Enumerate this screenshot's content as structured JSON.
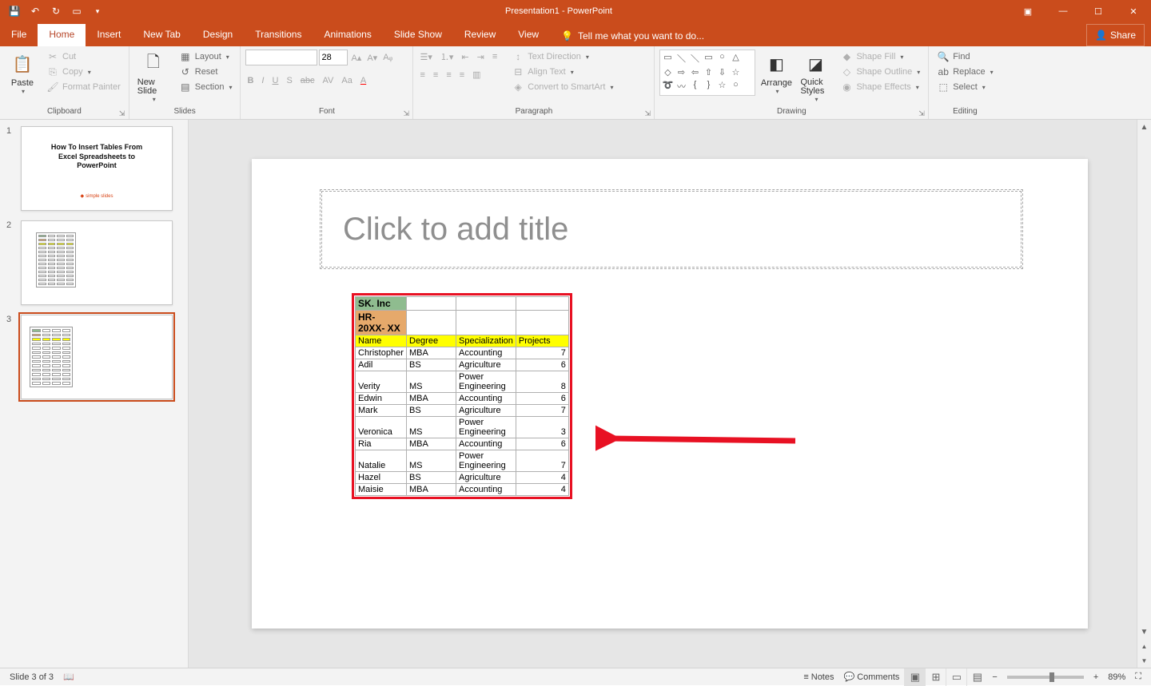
{
  "titlebar": {
    "title": "Presentation1 - PowerPoint"
  },
  "tabs": {
    "file": "File",
    "list": [
      "Home",
      "Insert",
      "New Tab",
      "Design",
      "Transitions",
      "Animations",
      "Slide Show",
      "Review",
      "View"
    ],
    "active": "Home",
    "tell_me": "Tell me what you want to do...",
    "share": "Share"
  },
  "ribbon": {
    "clipboard": {
      "label": "Clipboard",
      "paste": "Paste",
      "cut": "Cut",
      "copy": "Copy",
      "format_painter": "Format Painter"
    },
    "slides": {
      "label": "Slides",
      "new_slide": "New Slide",
      "layout": "Layout",
      "reset": "Reset",
      "section": "Section"
    },
    "font": {
      "label": "Font",
      "size": "28"
    },
    "paragraph": {
      "label": "Paragraph",
      "text_direction": "Text Direction",
      "align_text": "Align Text",
      "smartart": "Convert to SmartArt"
    },
    "drawing": {
      "label": "Drawing",
      "arrange": "Arrange",
      "quick_styles": "Quick Styles",
      "shape_fill": "Shape Fill",
      "shape_outline": "Shape Outline",
      "shape_effects": "Shape Effects"
    },
    "editing": {
      "label": "Editing",
      "find": "Find",
      "replace": "Replace",
      "select": "Select"
    }
  },
  "thumbnails": {
    "nums": [
      "1",
      "2",
      "3"
    ],
    "slide1_title": "How To Insert Tables From Excel Spreadsheets to PowerPoint",
    "slide1_logo": "simple slides"
  },
  "slide": {
    "title_placeholder": "Click to add title",
    "table": {
      "sk_inc": "SK. Inc",
      "hr": "HR- 20XX- XX",
      "headers": {
        "name": "Name",
        "degree": "Degree",
        "spec": "Specialization",
        "projects": "Projects"
      },
      "rows": [
        {
          "name": "Christopher",
          "degree": "MBA",
          "spec": "Accounting",
          "proj": "7"
        },
        {
          "name": "Adil",
          "degree": "BS",
          "spec": "Agriculture",
          "proj": "6"
        },
        {
          "name": "Verity",
          "degree": "MS",
          "spec": "Power Engineering",
          "proj": "8"
        },
        {
          "name": "Edwin",
          "degree": "MBA",
          "spec": "Accounting",
          "proj": "6"
        },
        {
          "name": "Mark",
          "degree": "BS",
          "spec": "Agriculture",
          "proj": "7"
        },
        {
          "name": "Veronica",
          "degree": "MS",
          "spec": "Power Engineering",
          "proj": "3"
        },
        {
          "name": "Ria",
          "degree": "MBA",
          "spec": "Accounting",
          "proj": "6"
        },
        {
          "name": "Natalie",
          "degree": "MS",
          "spec": "Power Engineering",
          "proj": "7"
        },
        {
          "name": "Hazel",
          "degree": "BS",
          "spec": "Agriculture",
          "proj": "4"
        },
        {
          "name": "Maisie",
          "degree": "MBA",
          "spec": "Accounting",
          "proj": "4"
        }
      ]
    }
  },
  "statusbar": {
    "slide_info": "Slide 3 of 3",
    "notes": "Notes",
    "comments": "Comments",
    "zoom": "89%"
  }
}
